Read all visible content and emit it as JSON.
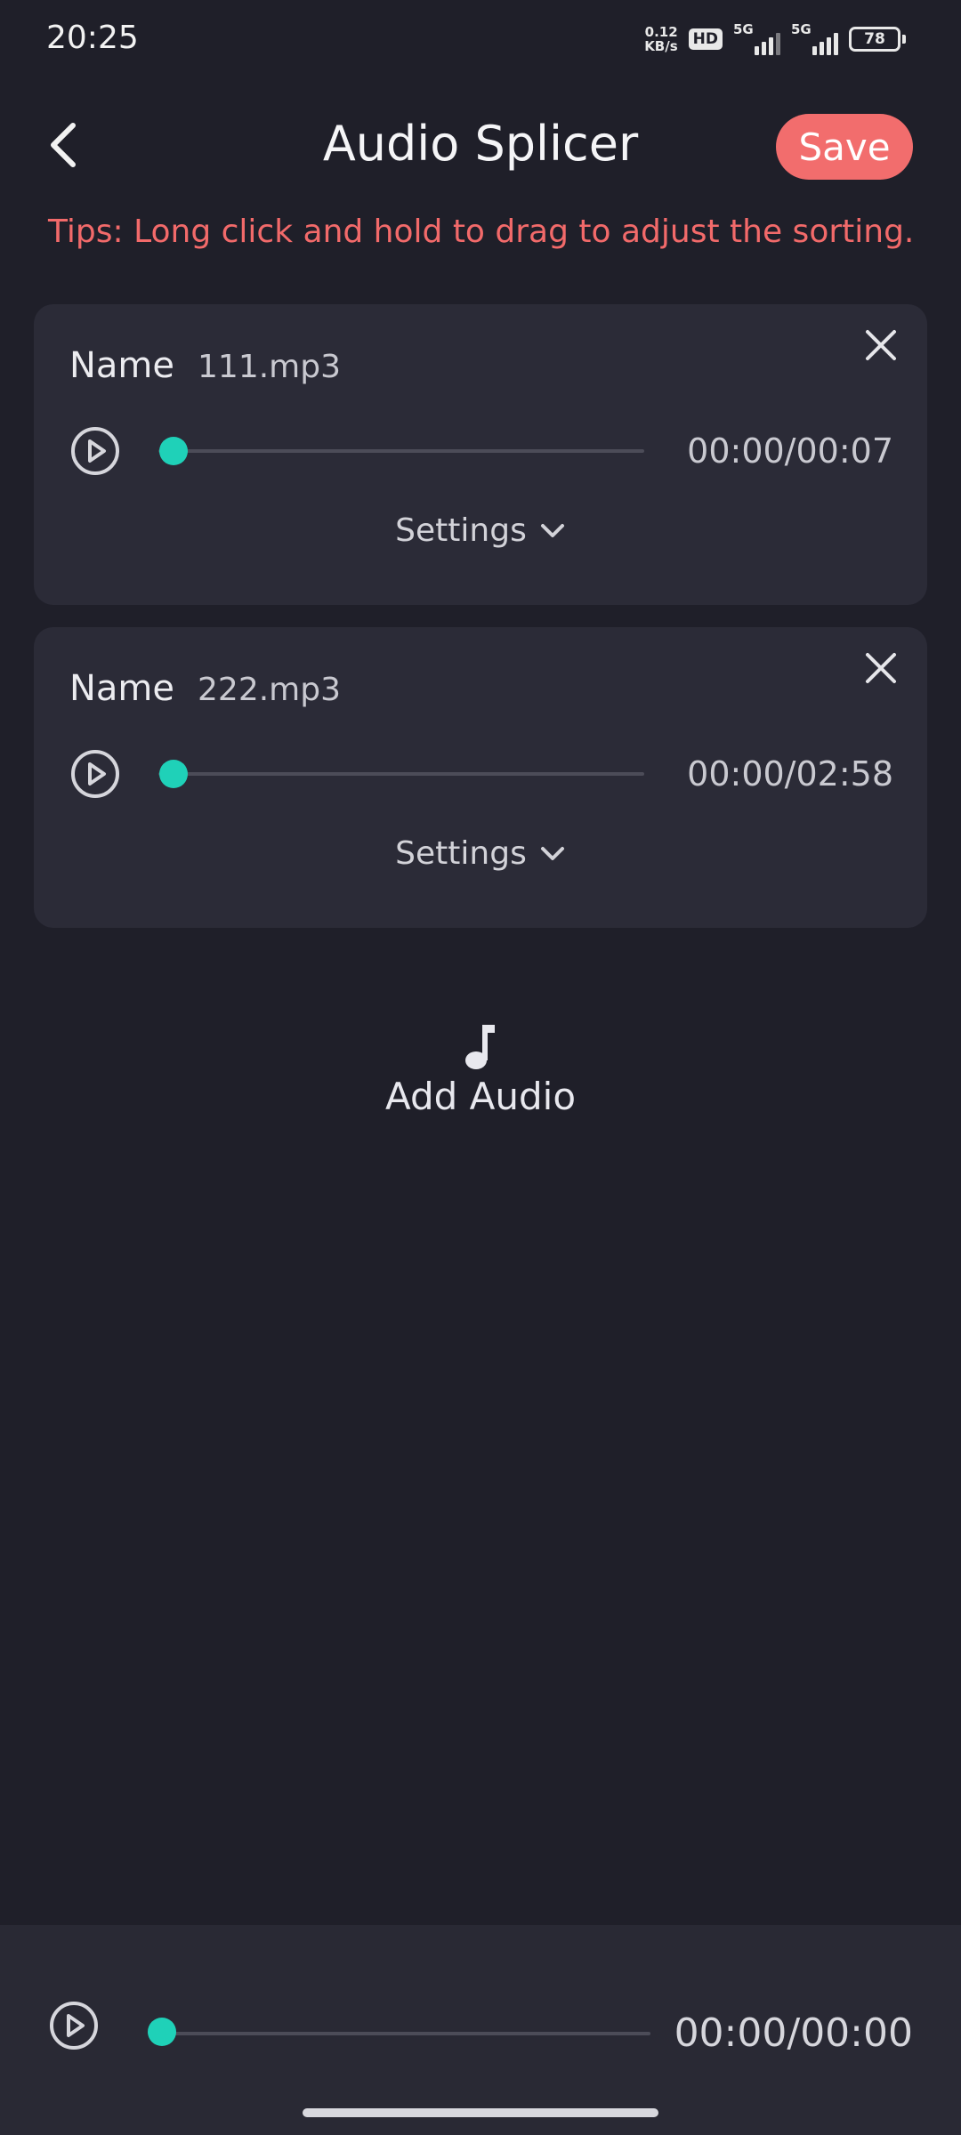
{
  "status_bar": {
    "time": "20:25",
    "net_speed_value": "0.12",
    "net_speed_unit": "KB/s",
    "hd_badge": "HD",
    "signal_1_label": "5G",
    "signal_2_label": "5G",
    "battery": "78"
  },
  "header": {
    "back_icon": "chevron-left-icon",
    "title": "Audio Splicer",
    "save_label": "Save"
  },
  "tips": "Tips: Long click and hold to drag to adjust the sorting.",
  "audio_items": [
    {
      "name_label": "Name",
      "file_name": "111.mp3",
      "time": "00:00/00:07",
      "progress": 0,
      "settings_label": "Settings"
    },
    {
      "name_label": "Name",
      "file_name": "222.mp3",
      "time": "00:00/02:58",
      "progress": 0,
      "settings_label": "Settings"
    }
  ],
  "add_audio": {
    "icon": "music-note-icon",
    "label": "Add Audio"
  },
  "bottom_player": {
    "time": "00:00/00:00",
    "progress": 0
  },
  "colors": {
    "background": "#1f1f29",
    "card": "#2b2b37",
    "accent_save": "#f26d6d",
    "tips_text": "#f26a6a",
    "progress_knob": "#1fd1b8"
  }
}
